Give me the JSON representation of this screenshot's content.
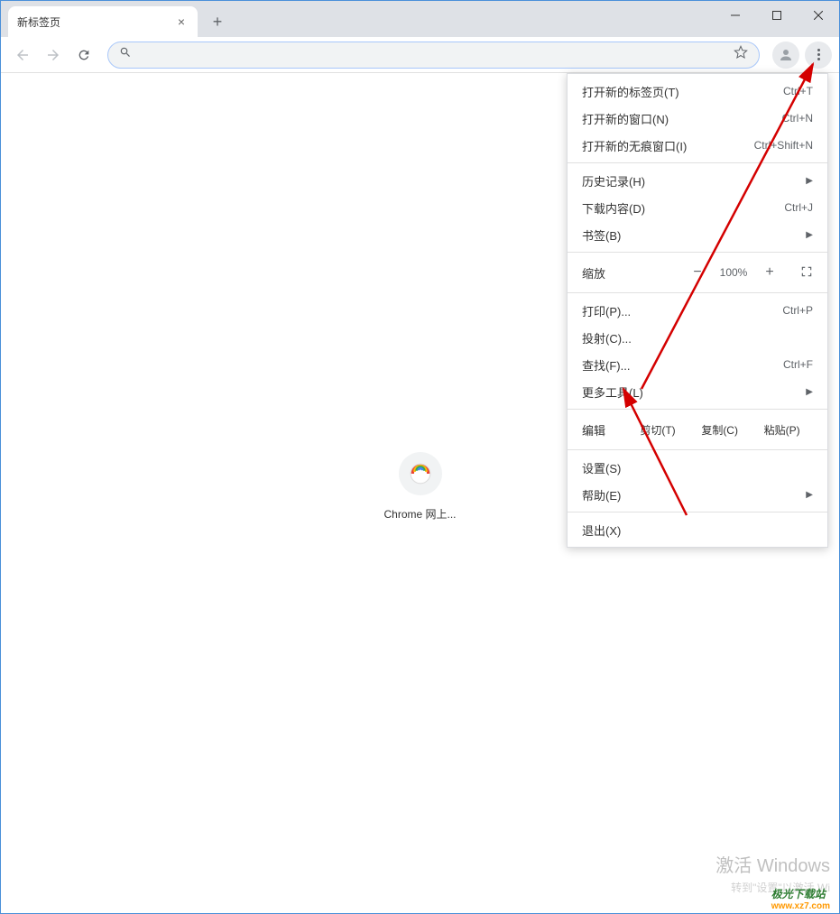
{
  "tab": {
    "title": "新标签页"
  },
  "menu": {
    "new_tab": {
      "label": "打开新的标签页(T)",
      "shortcut": "Ctrl+T"
    },
    "new_window": {
      "label": "打开新的窗口(N)",
      "shortcut": "Ctrl+N"
    },
    "new_incognito": {
      "label": "打开新的无痕窗口(I)",
      "shortcut": "Ctrl+Shift+N"
    },
    "history": {
      "label": "历史记录(H)"
    },
    "downloads": {
      "label": "下载内容(D)",
      "shortcut": "Ctrl+J"
    },
    "bookmarks": {
      "label": "书签(B)"
    },
    "zoom": {
      "label": "缩放",
      "value": "100%",
      "minus": "−",
      "plus": "+"
    },
    "print": {
      "label": "打印(P)...",
      "shortcut": "Ctrl+P"
    },
    "cast": {
      "label": "投射(C)..."
    },
    "find": {
      "label": "查找(F)...",
      "shortcut": "Ctrl+F"
    },
    "more_tools": {
      "label": "更多工具(L)"
    },
    "edit": {
      "label": "编辑",
      "cut": "剪切(T)",
      "copy": "复制(C)",
      "paste": "粘贴(P)"
    },
    "settings": {
      "label": "设置(S)"
    },
    "help": {
      "label": "帮助(E)"
    },
    "exit": {
      "label": "退出(X)"
    }
  },
  "shortcut_tile": {
    "label": "Chrome 网上..."
  },
  "watermark": {
    "title": "激活 Windows",
    "sub": "转到\"设置\"以激活 Wi"
  },
  "site": {
    "name": "极光下载站",
    "url": "www.xz7.com"
  }
}
